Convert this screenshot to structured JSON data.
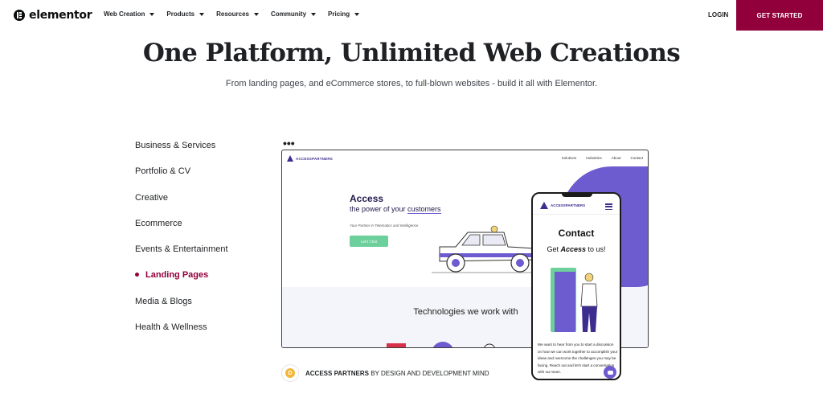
{
  "nav": {
    "brand": "elementor",
    "menu": [
      {
        "label": "Web Creation"
      },
      {
        "label": "Products"
      },
      {
        "label": "Resources"
      },
      {
        "label": "Community"
      },
      {
        "label": "Pricing"
      }
    ],
    "login": "LOGIN",
    "cta": "GET STARTED"
  },
  "hero": {
    "title": "One Platform, Unlimited Web Creations",
    "subtitle": "From landing pages, and eCommerce stores, to full-blown websites - build it all with Elementor."
  },
  "categories": [
    {
      "label": "Business & Services",
      "active": false
    },
    {
      "label": "Portfolio & CV",
      "active": false
    },
    {
      "label": "Creative",
      "active": false
    },
    {
      "label": "Ecommerce",
      "active": false
    },
    {
      "label": "Events & Entertainment",
      "active": false
    },
    {
      "label": "Landing Pages",
      "active": true
    },
    {
      "label": "Media & Blogs",
      "active": false
    },
    {
      "label": "Health & Wellness",
      "active": false
    }
  ],
  "preview": {
    "more": "•••",
    "site_logo": "ACCESSPARTNERS",
    "site_nav": [
      "Solutions",
      "Industries",
      "About",
      "Contact"
    ],
    "headline": "Access",
    "sub_prefix": "the power of your ",
    "sub_highlight": "customers",
    "tagline": "Your Partner in Telematics and Intelligence",
    "button": "Let's Chat",
    "tech_heading": "Technologies we work with"
  },
  "mobile": {
    "logo": "ACCESSPARTNERS",
    "title": "Contact",
    "get_prefix": "Get ",
    "get_emph": "Access",
    "get_suffix": " to us!",
    "body": "We want to hear from you to start a discussion on how we can work together to accomplish your ideas and overcome the challenges you may be facing. Reach out and let's start a conversation with our team."
  },
  "credit": {
    "badge": "D",
    "name": "ACCESS PARTNERS",
    "by": " BY DESIGN AND DEVELOPMENT MIND"
  },
  "colors": {
    "accent": "#92003b",
    "purple": "#6d5bd0",
    "green": "#6ccf9c"
  }
}
